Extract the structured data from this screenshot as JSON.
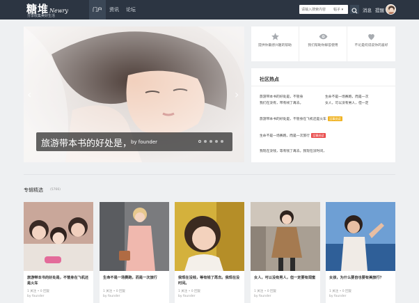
{
  "header": {
    "logo": "糖堆",
    "logo_en": "Newry",
    "logo_tagline": "分享收集美好生活",
    "nav": [
      "门户",
      "资讯",
      "论坛"
    ],
    "search_placeholder": "请输入搜索内容",
    "search_scope": "帖子",
    "messages": "消息",
    "reminders": "提醒"
  },
  "hero": {
    "title": "旅游带本书的好处是，",
    "author": "by founder",
    "slide_count": 5,
    "active_slide": 1
  },
  "actions": [
    {
      "icon": "star-icon",
      "label": "提供你最感兴趣的帮助"
    },
    {
      "icon": "eye-icon",
      "label": "我们帮助你解答使用"
    },
    {
      "icon": "heart-icon",
      "label": "不论是何说说你的喜好"
    }
  ],
  "hot": {
    "title": "社区热点",
    "items": [
      {
        "text": "旅游带本书的好处是，不管身",
        "line2": "我们在没有，带有线了再去。"
      },
      {
        "text": "生命不是一场赛跑，而是一次",
        "line2": "女人，可以没有男人，但一定"
      },
      {
        "text": "旅游带本书的好处是，不管身在飞机还是火车",
        "tag": "没事阅读"
      },
      {
        "text": "生命不是一场赛跑，而是一次旅行",
        "tag": "没事阅读"
      },
      {
        "text": "我现在没钱，等有钱了再去。我现在没时间，"
      }
    ]
  },
  "section": {
    "title": "专辑精选",
    "count": "(5766)"
  },
  "cards": [
    {
      "title": "旅游带本书的好处是，不管身在飞机还是火车",
      "meta": "1 关注 • 0 回复",
      "author": "by founder"
    },
    {
      "title": "生命不是一场赛跑，而是一次旅行",
      "meta": "1 关注 • 0 回复",
      "author": "by founder"
    },
    {
      "title": "我现在没钱，等有钱了再去。我现在没时间。",
      "meta": "1 关注 • 0 回复",
      "author": "by founder"
    },
    {
      "title": "女人，可以没有男人，但一定要有闺蜜",
      "meta": "1 关注 • 0 回复",
      "author": "by founder"
    },
    {
      "title": "女孩，为什么要自也要有美旅行？",
      "meta": "1 关注 • 0 回复",
      "author": "by founder"
    }
  ],
  "colors": {
    "header_bg": "#2c3542",
    "page_bg": "#eef0f2",
    "tag_yellow": "#f0b323",
    "tag_red": "#e94b4b"
  }
}
